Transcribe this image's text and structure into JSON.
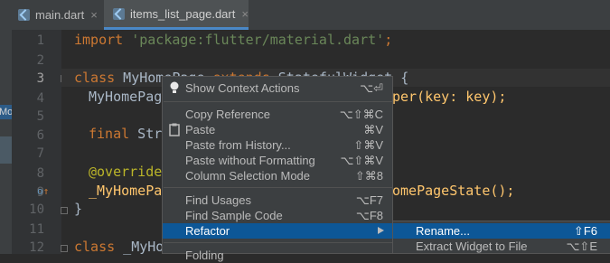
{
  "tabs": [
    {
      "label": "main.dart",
      "close": "×",
      "icon": "dart-file-icon"
    },
    {
      "label": "items_list_page.dart",
      "close": "×",
      "icon": "dart-file-icon",
      "active": true
    }
  ],
  "tool_strip": {
    "label": "Mo"
  },
  "line_numbers": [
    "1",
    "2",
    "3",
    "4",
    "5",
    "6",
    "7",
    "8",
    "9",
    "10",
    "11",
    "12"
  ],
  "code": {
    "l1_kw": "import",
    "l1_str": "'package:flutter/material.dart'",
    "l1_end": ";",
    "l3_kw": "class",
    "l3_rest": " MyHomePage ",
    "l3_kw2": "extends",
    "l3_rest2": " StatefulWidget {",
    "l4_a": "MyHomePage",
    "l4_b": "per(key: key);",
    "l6_kw": "final",
    "l6_rest": " Str",
    "l8_ann": "@override",
    "l9_a": "_MyHomePa",
    "l9_b": "omePageState();",
    "l10": "}",
    "l12_kw": "class",
    "l12_rest": " _MyHom"
  },
  "context_menu": {
    "items": [
      {
        "label": "Show Context Actions",
        "shortcut": "⌥⏎",
        "icon": "bulb-icon"
      },
      {
        "label": "Copy Reference",
        "shortcut": "⌥⇧⌘C"
      },
      {
        "label": "Paste",
        "shortcut": "⌘V",
        "icon": "clipboard-icon"
      },
      {
        "label": "Paste from History...",
        "shortcut": "⇧⌘V"
      },
      {
        "label": "Paste without Formatting",
        "shortcut": "⌥⇧⌘V"
      },
      {
        "label": "Column Selection Mode",
        "shortcut": "⇧⌘8"
      },
      {
        "label": "Find Usages",
        "shortcut": "⌥F7"
      },
      {
        "label": "Find Sample Code",
        "shortcut": "⌥F8"
      },
      {
        "label": "Refactor",
        "submenu": true,
        "selected": true
      },
      {
        "label": "Folding"
      }
    ]
  },
  "refactor_submenu": {
    "items": [
      {
        "label": "Rename...",
        "shortcut": "⇧F6",
        "selected": true
      },
      {
        "label": "Extract Widget to File",
        "shortcut": "⌥⇧E"
      }
    ]
  },
  "colors": {
    "accent": "#0d5797",
    "background": "#2b2b2b",
    "keyword": "#cc7832",
    "string": "#6a8759"
  }
}
